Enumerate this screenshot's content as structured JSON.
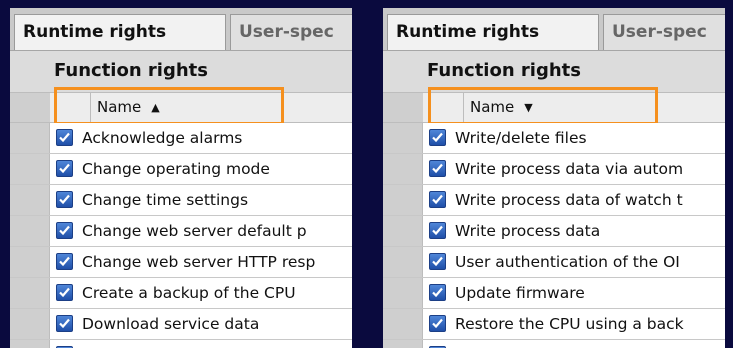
{
  "panels": [
    {
      "tabs": [
        "Runtime rights",
        "User-spec"
      ],
      "section_title": "Function rights",
      "column_header": "Name",
      "sort_direction": "ascending",
      "items": [
        "Acknowledge alarms",
        "Change operating mode",
        "Change time settings",
        "Change web server default p",
        "Change web server HTTP resp",
        "Create a backup of the CPU",
        "Download service data"
      ]
    },
    {
      "tabs": [
        "Runtime rights",
        "User-spec"
      ],
      "section_title": "Function rights",
      "column_header": "Name",
      "sort_direction": "descending",
      "items": [
        "Write/delete files",
        "Write process data via autom",
        "Write process data of watch t",
        "Write process data",
        "User authentication of the OI",
        "Update firmware",
        "Restore the CPU using a back"
      ]
    }
  ],
  "colors": {
    "highlight": "#f5901e",
    "background": "#0a0a3e",
    "checkbox": "#2f63c0"
  }
}
